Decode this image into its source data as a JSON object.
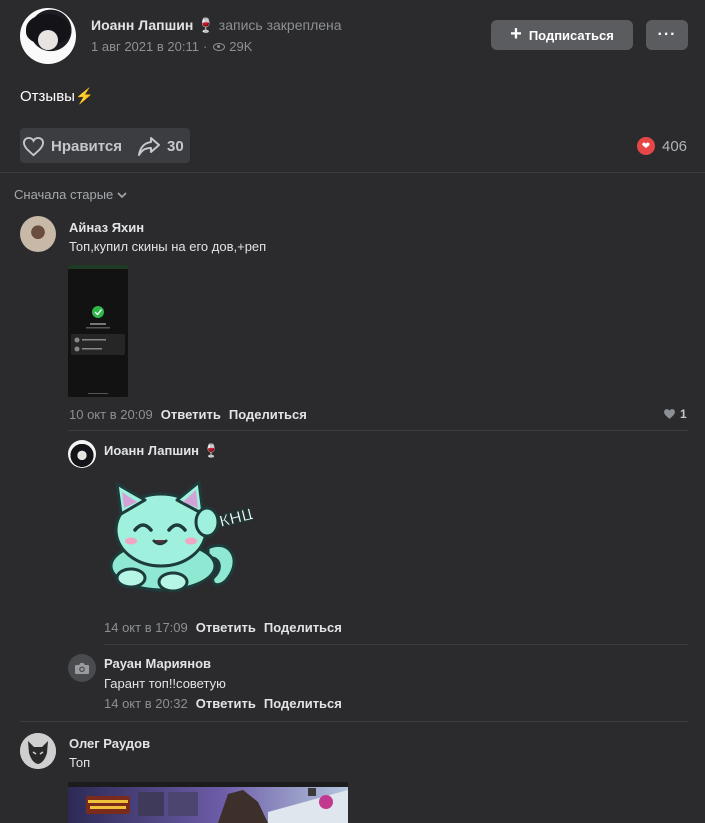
{
  "post": {
    "author": "Иоанн Лапшин",
    "author_emoji": "🍷",
    "pinned_label": "запись закреплена",
    "date": "1 авг 2021 в 20:11",
    "views": "29K",
    "subscribe_label": "Подписаться",
    "more_label": "···",
    "text": "Отзывы⚡",
    "like_label": "Нравится",
    "share_count": "30",
    "reactions_count": "406"
  },
  "sort_label": "Сначала старые",
  "comments": [
    {
      "author": "Айназ Яхин",
      "text": "Топ,купил скины на его дов,+реп",
      "date": "10 окт в 20:09",
      "reply_label": "Ответить",
      "share_label": "Поделиться",
      "likes": "1"
    },
    {
      "author": "Иоанн Лапшин",
      "author_emoji": "🍷",
      "sticker_text": "КНШ",
      "date": "14 окт в 17:09",
      "reply_label": "Ответить",
      "share_label": "Поделиться"
    },
    {
      "author": "Рауан Мариянов",
      "text": "Гарант топ!!советую",
      "date": "14 окт в 20:32",
      "reply_label": "Ответить",
      "share_label": "Поделиться"
    },
    {
      "author": "Олег Раудов",
      "text": "Топ"
    }
  ],
  "colors": {
    "background": "#2b2b2d",
    "button": "#5b5c5f",
    "reaction": "#e64646",
    "sticker": "#7de0c8"
  },
  "icons": [
    "plus-icon",
    "more-icon",
    "eye-icon",
    "heart-icon",
    "share-icon",
    "reaction-heart-icon",
    "chevron-down-icon",
    "camera-icon",
    "like-heart-icon"
  ]
}
